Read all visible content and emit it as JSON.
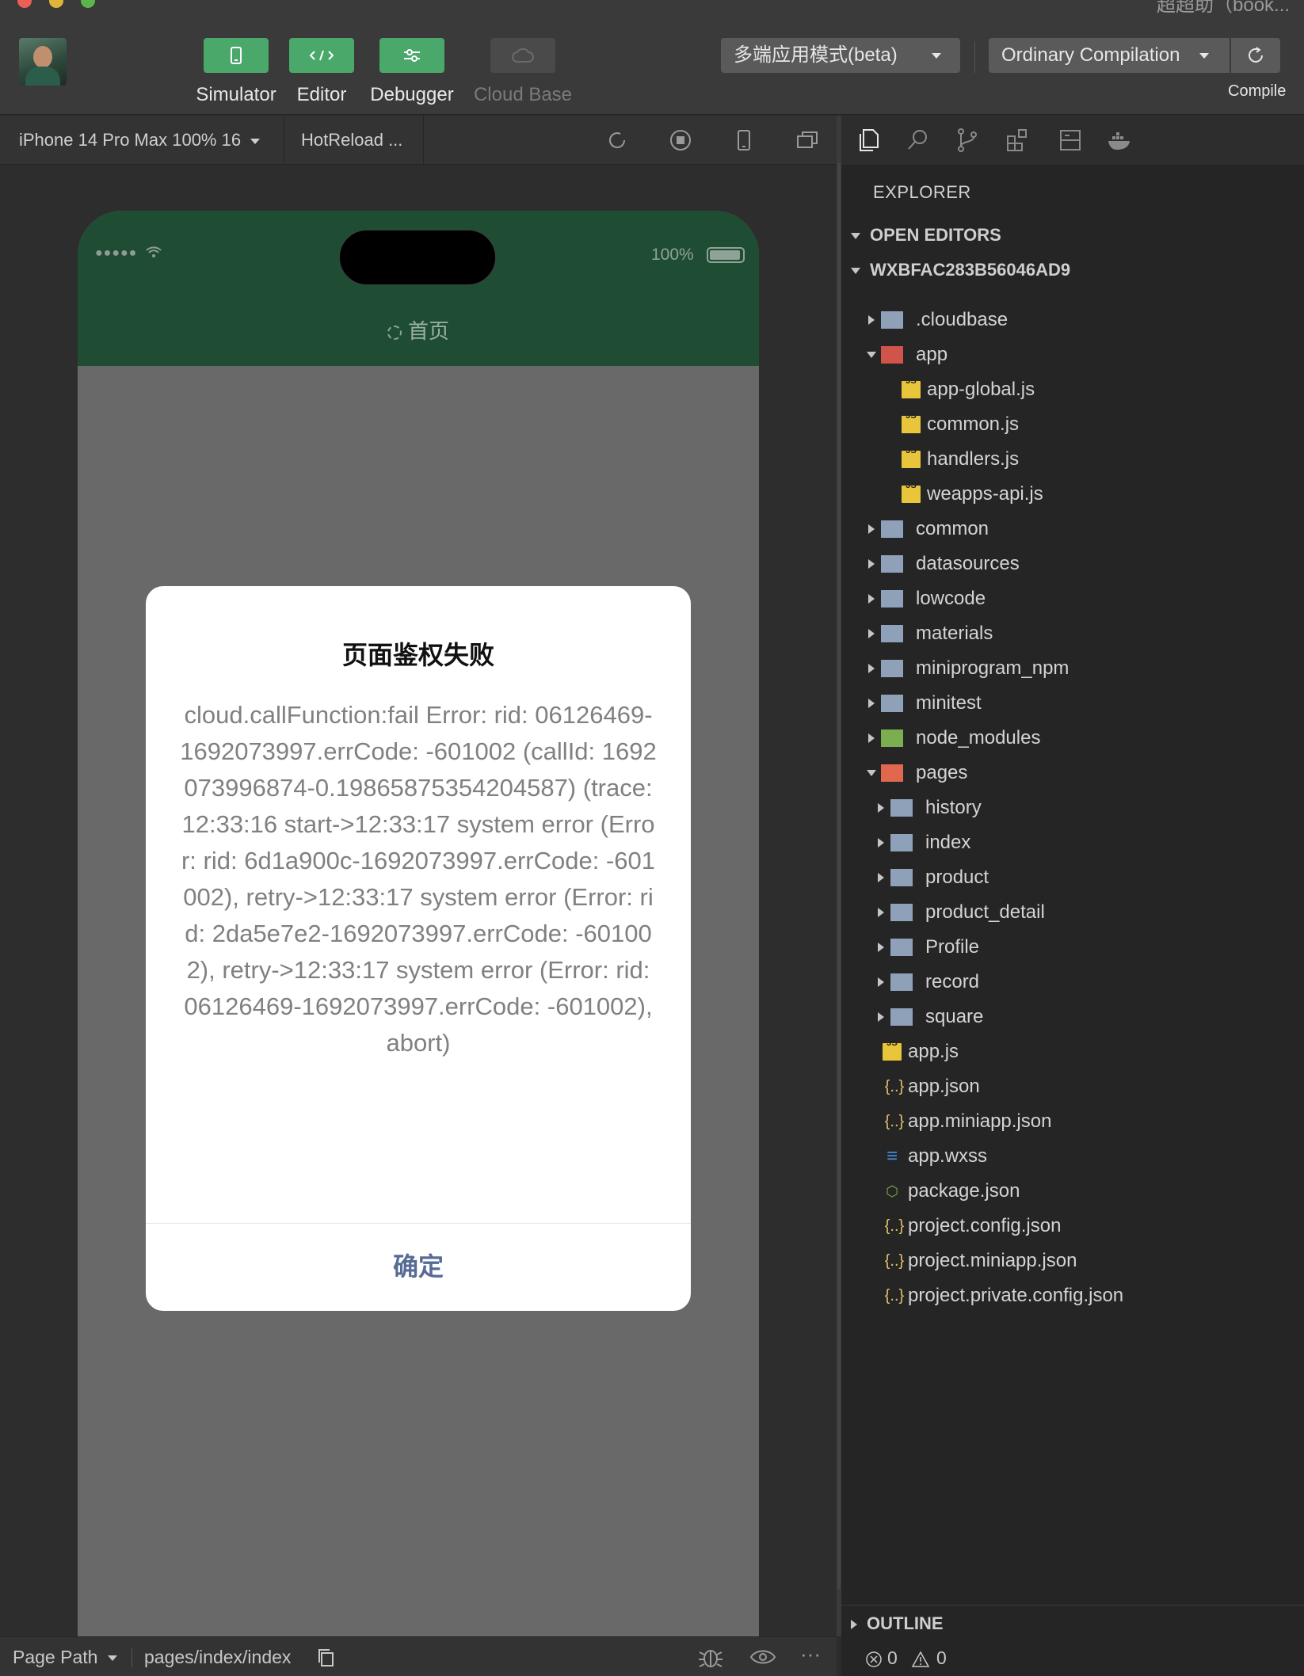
{
  "window": {
    "title": "超超助（book..."
  },
  "toolbar": {
    "simulator": "Simulator",
    "editor": "Editor",
    "debugger": "Debugger",
    "cloud_base": "Cloud Base",
    "mode_select": "多端应用模式(beta)",
    "compile_select": "Ordinary Compilation",
    "compile_label": "Compile",
    "accent_color": "#4aa96a"
  },
  "sim_bar": {
    "device": "iPhone 14 Pro Max 100% 16",
    "hotreload": "HotReload ..."
  },
  "phone": {
    "battery": "100%",
    "nav_title": "首页",
    "nav_color": "#1f4d33"
  },
  "dialog": {
    "title": "页面鉴权失败",
    "message": "cloud.callFunction:fail Error: rid: 06126469-1692073997.errCode: -601002 (callId: 1692073996874-0.19865875354204587) (trace: 12:33:16 start->12:33:17 system error (Error: rid: 6d1a900c-1692073997.errCode: -601002), retry->12:33:17 system error (Error: rid: 2da5e7e2-1692073997.errCode: -601002), retry->12:33:17 system error (Error: rid: 06126469-1692073997.errCode: -601002), abort)",
    "confirm": "确定",
    "confirm_color": "#576b95"
  },
  "explorer": {
    "header": "EXPLORER",
    "open_editors": "OPEN EDITORS",
    "project": "WXBFAC283B56046AD9",
    "tree": [
      {
        "name": ".cloudbase",
        "type": "folder",
        "depth": 1,
        "state": "collapsed"
      },
      {
        "name": "app",
        "type": "folder-app",
        "depth": 1,
        "state": "expanded"
      },
      {
        "name": "app-global.js",
        "type": "js",
        "depth": 2
      },
      {
        "name": "common.js",
        "type": "js",
        "depth": 2
      },
      {
        "name": "handlers.js",
        "type": "js",
        "depth": 2
      },
      {
        "name": "weapps-api.js",
        "type": "js",
        "depth": 2
      },
      {
        "name": "common",
        "type": "folder",
        "depth": 1,
        "state": "collapsed"
      },
      {
        "name": "datasources",
        "type": "folder",
        "depth": 1,
        "state": "collapsed"
      },
      {
        "name": "lowcode",
        "type": "folder",
        "depth": 1,
        "state": "collapsed"
      },
      {
        "name": "materials",
        "type": "folder",
        "depth": 1,
        "state": "collapsed"
      },
      {
        "name": "miniprogram_npm",
        "type": "folder",
        "depth": 1,
        "state": "collapsed"
      },
      {
        "name": "minitest",
        "type": "folder",
        "depth": 1,
        "state": "collapsed"
      },
      {
        "name": "node_modules",
        "type": "folder-node",
        "depth": 1,
        "state": "collapsed"
      },
      {
        "name": "pages",
        "type": "folder-pages",
        "depth": 1,
        "state": "expanded"
      },
      {
        "name": "history",
        "type": "folder",
        "depth": 2,
        "state": "collapsed"
      },
      {
        "name": "index",
        "type": "folder",
        "depth": 2,
        "state": "collapsed"
      },
      {
        "name": "product",
        "type": "folder",
        "depth": 2,
        "state": "collapsed"
      },
      {
        "name": "product_detail",
        "type": "folder",
        "depth": 2,
        "state": "collapsed"
      },
      {
        "name": "Profile",
        "type": "folder",
        "depth": 2,
        "state": "collapsed"
      },
      {
        "name": "record",
        "type": "folder",
        "depth": 2,
        "state": "collapsed"
      },
      {
        "name": "square",
        "type": "folder",
        "depth": 2,
        "state": "collapsed"
      },
      {
        "name": "app.js",
        "type": "js",
        "depth": 1
      },
      {
        "name": "app.json",
        "type": "json",
        "depth": 1
      },
      {
        "name": "app.miniapp.json",
        "type": "json",
        "depth": 1
      },
      {
        "name": "app.wxss",
        "type": "css",
        "depth": 1
      },
      {
        "name": "package.json",
        "type": "pkg",
        "depth": 1
      },
      {
        "name": "project.config.json",
        "type": "json",
        "depth": 1
      },
      {
        "name": "project.miniapp.json",
        "type": "json",
        "depth": 1
      },
      {
        "name": "project.private.config.json",
        "type": "json",
        "depth": 1
      }
    ],
    "outline": "OUTLINE"
  },
  "status": {
    "page_path_label": "Page Path",
    "page_path": "pages/index/index",
    "errors": "0",
    "warnings": "0"
  }
}
